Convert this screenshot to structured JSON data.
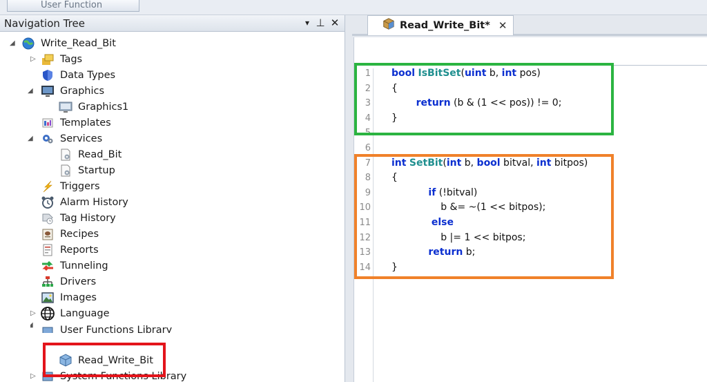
{
  "top": {
    "button_label": "User Function"
  },
  "nav": {
    "title": "Navigation Tree",
    "controls": {
      "dropdown": "▾",
      "pin": "⊥",
      "close": "✕"
    },
    "items": [
      {
        "label": "Write_Read_Bit",
        "icon": "globe-project-icon"
      },
      {
        "label": "Tags",
        "icon": "tags-icon"
      },
      {
        "label": "Data Types",
        "icon": "shield-icon"
      },
      {
        "label": "Graphics",
        "icon": "monitor-icon"
      },
      {
        "label": "Graphics1",
        "icon": "monitor-icon"
      },
      {
        "label": "Templates",
        "icon": "templates-icon"
      },
      {
        "label": "Services",
        "icon": "gears-icon"
      },
      {
        "label": "Read_Bit",
        "icon": "service-doc-icon"
      },
      {
        "label": "Startup",
        "icon": "service-doc-icon"
      },
      {
        "label": "Triggers",
        "icon": "lightning-icon"
      },
      {
        "label": "Alarm History",
        "icon": "alarm-clock-icon"
      },
      {
        "label": "Tag History",
        "icon": "tag-history-icon"
      },
      {
        "label": "Recipes",
        "icon": "recipes-icon"
      },
      {
        "label": "Reports",
        "icon": "reports-icon"
      },
      {
        "label": "Tunneling",
        "icon": "tunneling-icon"
      },
      {
        "label": "Drivers",
        "icon": "drivers-icon"
      },
      {
        "label": "Images",
        "icon": "images-icon"
      },
      {
        "label": "Language",
        "icon": "language-globe-icon"
      },
      {
        "label": "User Functions Library",
        "icon": "library-icon"
      },
      {
        "label": "Read_Write_Bit",
        "icon": "function-cube-icon"
      },
      {
        "label": "System Functions Library",
        "icon": "library-icon"
      }
    ]
  },
  "editor": {
    "tab": {
      "label": "Read_Write_Bit*",
      "close": "✕"
    },
    "lines": [
      {
        "n": "1",
        "parts": [
          [
            "kw",
            "bool"
          ],
          [
            "t",
            " "
          ],
          [
            "fn",
            "IsBitSet"
          ],
          [
            "t",
            "("
          ],
          [
            "kw",
            "uint"
          ],
          [
            "t",
            " b, "
          ],
          [
            "kw",
            "int"
          ],
          [
            "t",
            " pos)"
          ]
        ]
      },
      {
        "n": "2",
        "parts": [
          [
            "t",
            "{"
          ]
        ]
      },
      {
        "n": "3",
        "parts": [
          [
            "t",
            "        "
          ],
          [
            "kw",
            "return"
          ],
          [
            "t",
            " (b & (1 << pos)) != 0;"
          ]
        ]
      },
      {
        "n": "4",
        "parts": [
          [
            "t",
            "}"
          ]
        ]
      },
      {
        "n": "5",
        "parts": []
      },
      {
        "n": "6",
        "parts": []
      },
      {
        "n": "7",
        "parts": [
          [
            "kw",
            "int"
          ],
          [
            "t",
            " "
          ],
          [
            "fn",
            "SetBit"
          ],
          [
            "t",
            "("
          ],
          [
            "kw",
            "int"
          ],
          [
            "t",
            " b, "
          ],
          [
            "kw",
            "bool"
          ],
          [
            "t",
            " bitval, "
          ],
          [
            "kw",
            "int"
          ],
          [
            "t",
            " bitpos)"
          ]
        ]
      },
      {
        "n": "8",
        "parts": [
          [
            "t",
            "{"
          ]
        ]
      },
      {
        "n": "9",
        "parts": [
          [
            "t",
            "            "
          ],
          [
            "kw",
            "if"
          ],
          [
            "t",
            " (!bitval)"
          ]
        ]
      },
      {
        "n": "10",
        "parts": [
          [
            "t",
            "                b &= ~(1 << bitpos);"
          ]
        ]
      },
      {
        "n": "11",
        "parts": [
          [
            "t",
            "             "
          ],
          [
            "kw",
            "else"
          ]
        ]
      },
      {
        "n": "12",
        "parts": [
          [
            "t",
            "                b |= 1 << bitpos;"
          ]
        ]
      },
      {
        "n": "13",
        "parts": [
          [
            "t",
            "            "
          ],
          [
            "kw",
            "return"
          ],
          [
            "t",
            " b;"
          ]
        ]
      },
      {
        "n": "14",
        "parts": [
          [
            "t",
            "}"
          ]
        ]
      }
    ]
  },
  "colors": {
    "highlight_red": "#e3141b",
    "highlight_green": "#2bb441",
    "highlight_orange": "#f0812a",
    "keyword": "#0b2fd0",
    "function_name": "#1f8f8f"
  }
}
